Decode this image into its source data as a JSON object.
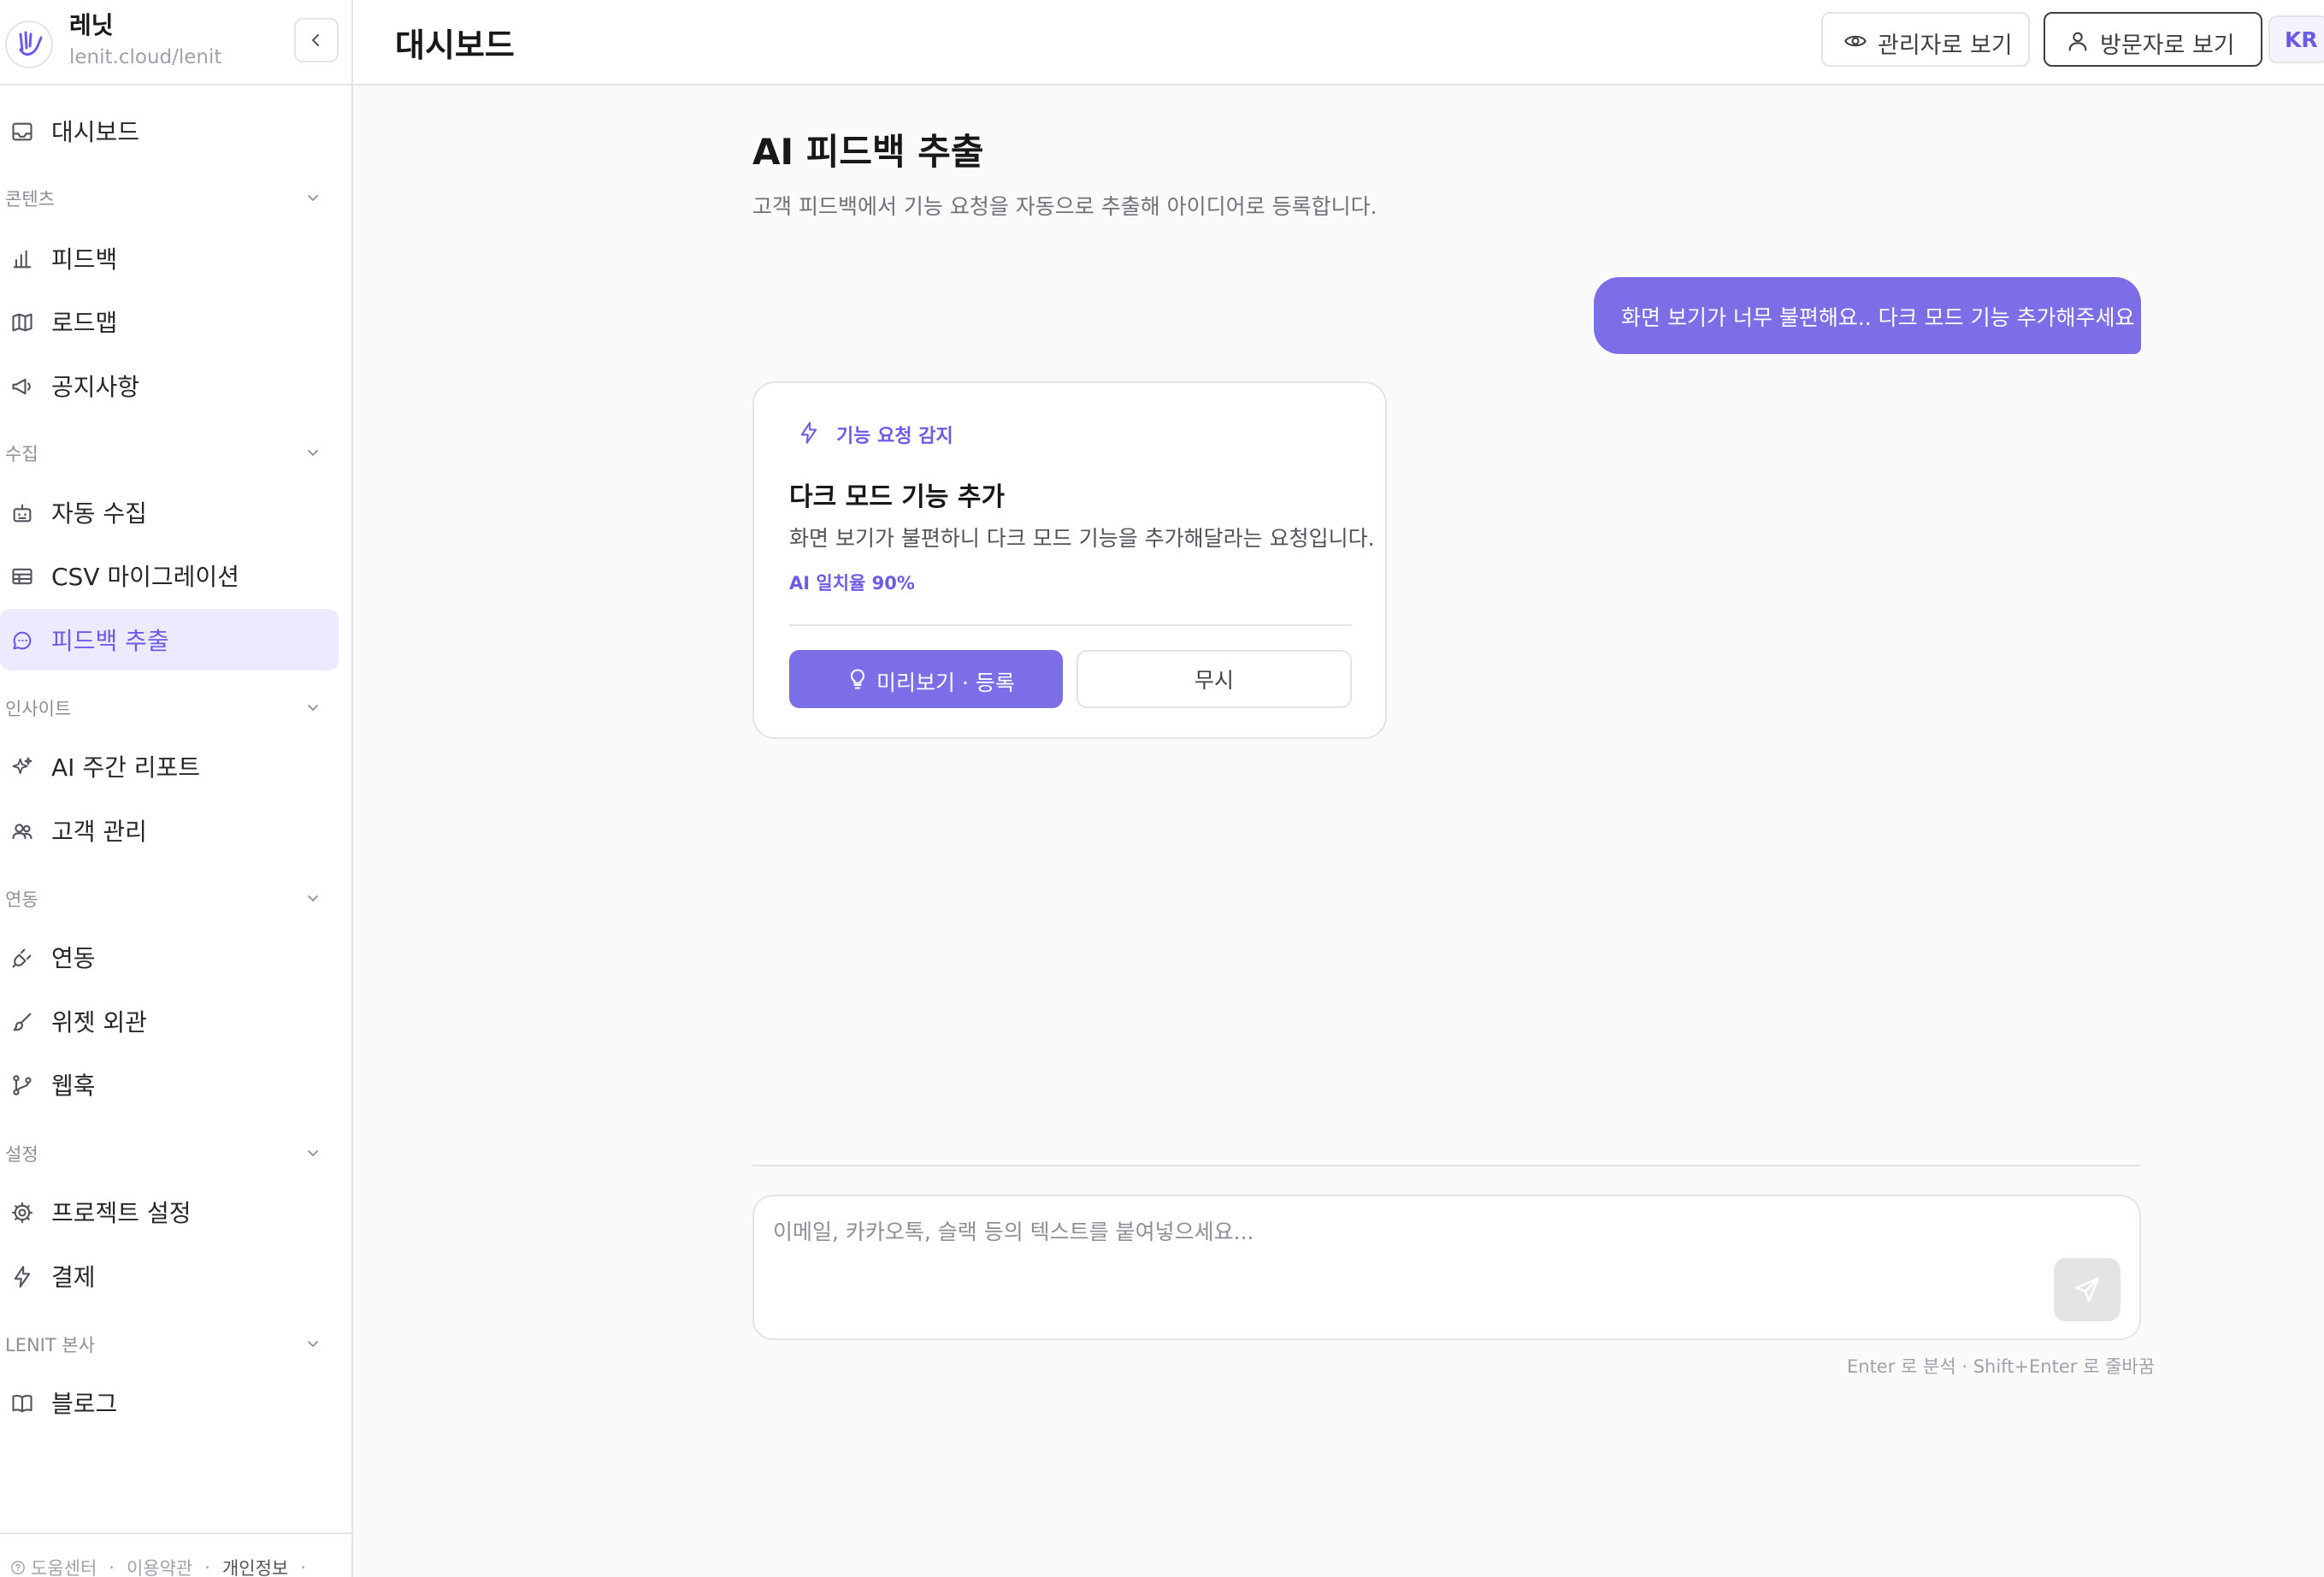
{
  "brand": {
    "name": "레닛",
    "url": "lenit.cloud/lenit"
  },
  "sidebar": {
    "top_item": {
      "label": "대시보드",
      "icon": "inbox-icon"
    },
    "sections": [
      {
        "label": "콘텐츠",
        "items": [
          {
            "label": "피드백",
            "icon": "bar-chart-icon"
          },
          {
            "label": "로드맵",
            "icon": "map-icon"
          },
          {
            "label": "공지사항",
            "icon": "megaphone-icon"
          }
        ]
      },
      {
        "label": "수집",
        "items": [
          {
            "label": "자동 수집",
            "icon": "robot-icon"
          },
          {
            "label": "CSV 마이그레이션",
            "icon": "table-icon"
          },
          {
            "label": "피드백 추출",
            "icon": "message-circle-icon",
            "active": true
          }
        ]
      },
      {
        "label": "인사이트",
        "items": [
          {
            "label": "AI 주간 리포트",
            "icon": "sparkles-icon"
          },
          {
            "label": "고객 관리",
            "icon": "users-icon"
          }
        ]
      },
      {
        "label": "연동",
        "items": [
          {
            "label": "연동",
            "icon": "plug-icon"
          },
          {
            "label": "위젯 외관",
            "icon": "brush-icon"
          },
          {
            "label": "웹훅",
            "icon": "git-branch-icon"
          }
        ]
      },
      {
        "label": "설정",
        "items": [
          {
            "label": "프로젝트 설정",
            "icon": "gear-icon"
          },
          {
            "label": "결제",
            "icon": "zap-icon"
          }
        ]
      },
      {
        "label": "LENIT 본사",
        "items": [
          {
            "label": "블로그",
            "icon": "book-icon"
          }
        ]
      }
    ],
    "footer": {
      "help": "도움센터",
      "terms": "이용약관",
      "privacy": "개인정보"
    }
  },
  "header": {
    "title": "대시보드",
    "admin_view": "관리자로 보기",
    "visitor_view": "방문자로 보기",
    "language": "KR"
  },
  "main": {
    "title": "AI 피드백 추출",
    "subtitle": "고객 피드백에서 기능 요청을 자동으로 추출해 아이디어로 등록합니다.",
    "user_message": "화면 보기가 너무 불편해요.. 다크 모드 기능 추가해주세요",
    "result": {
      "tag": "기능 요청 감지",
      "title": "다크 모드 기능 추가",
      "description": "화면 보기가 불편하니 다크 모드 기능을 추가해달라는 요청입니다.",
      "score": "AI 일치율 90%",
      "primary_button": "미리보기 · 등록",
      "secondary_button": "무시"
    },
    "compose": {
      "placeholder": "이메일, 카카오톡, 슬랙 등의 텍스트를 붙여넣으세요...",
      "value": "",
      "hint": "Enter 로 분석 · Shift+Enter 로 줄바꿈"
    }
  },
  "colors": {
    "accent": "#7c6ee6",
    "accent_text": "#6b5ce7",
    "active_bg": "#ede9fe"
  }
}
